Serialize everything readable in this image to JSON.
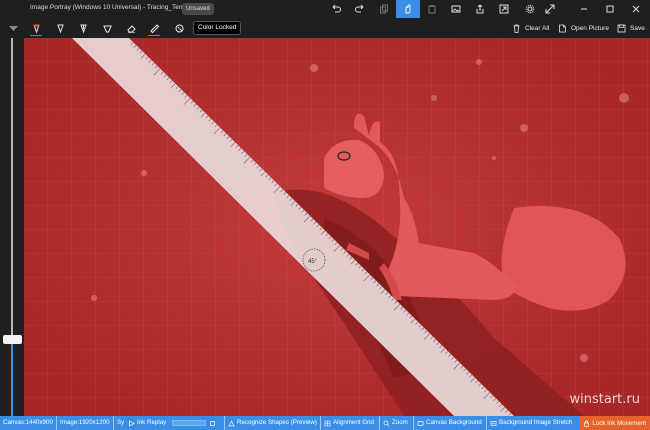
{
  "window": {
    "title": "Image Portray (Windows 10 Universal)  -  Tracing_Temp.ink",
    "status_badge": "Unsaved"
  },
  "toolbar": {
    "tooltip": "Color Locked",
    "clear_all": "Clear All",
    "open_picture": "Open Picture",
    "save": "Save"
  },
  "slider": {
    "level": 0.2
  },
  "canvas": {
    "background_color": "#b52e2e",
    "ruler_angle_label": "45°"
  },
  "statusbar": {
    "canvas_size": "Canvas:1440x900",
    "image_size": "Image:1920x1200",
    "sync": "Sy",
    "ink_replay": "Ink Replay",
    "recognize_shapes": "Recognize Shapes (Preview)",
    "alignment_grid": "Alignment Grid",
    "zoom": "Zoom",
    "canvas_background": "Canvas Background",
    "background_stretch": "Background Image Stretch",
    "lock_ink": "Lock Ink Movement"
  },
  "watermark": "winstart.ru",
  "colors": {
    "accent": "#3a8ee6",
    "lock": "#e8632b"
  }
}
